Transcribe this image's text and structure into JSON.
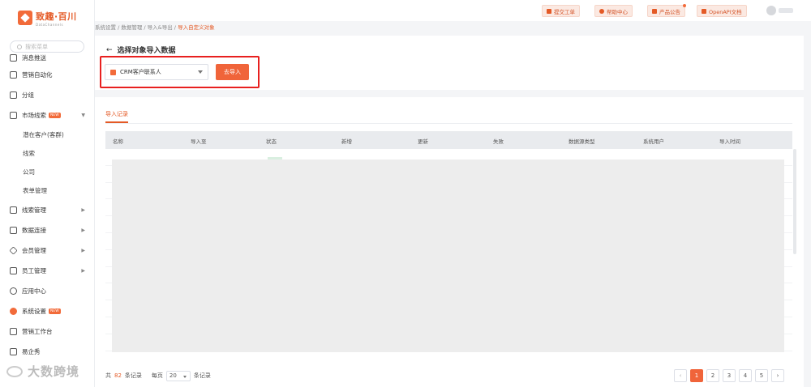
{
  "app": {
    "logo_main": "致趣·百川",
    "logo_sub": "DataChannels"
  },
  "sidebar": {
    "search_placeholder": "搜索菜单",
    "items": [
      {
        "label": "消息推送"
      },
      {
        "label": "营销自动化"
      },
      {
        "label": "分组"
      },
      {
        "label": "市场线索",
        "badge": "NEW"
      },
      {
        "label": "潜在客户(客群)"
      },
      {
        "label": "线索"
      },
      {
        "label": "公司"
      },
      {
        "label": "表单管理"
      },
      {
        "label": "线索管理"
      },
      {
        "label": "数据连接"
      },
      {
        "label": "会员管理"
      },
      {
        "label": "员工管理"
      },
      {
        "label": "应用中心"
      },
      {
        "label": "系统设置",
        "badge": "NEW"
      },
      {
        "label": "营销工作台"
      },
      {
        "label": "易企秀"
      }
    ]
  },
  "topbar": {
    "buttons": [
      "提交工单",
      "帮助中心",
      "产品公告",
      "OpenAPI文档"
    ]
  },
  "breadcrumb": {
    "items": [
      "系统设置",
      "数据管理",
      "导入&导出"
    ],
    "current": "导入自定义对象"
  },
  "import_panel": {
    "title": "选择对象导入数据",
    "select_value": "CRM客户联系人",
    "go_button": "去导入"
  },
  "records": {
    "tab": "导入记录",
    "columns": [
      "名称",
      "导入至",
      "状态",
      "新增",
      "更新",
      "失败",
      "数据源类型",
      "系统用户",
      "导入时间"
    ]
  },
  "footer": {
    "total_prefix": "共",
    "total": "82",
    "total_suffix": "条记录",
    "per_page_label": "每页",
    "per_page_value": "20",
    "per_page_suffix": "条记录",
    "pages": [
      "1",
      "2",
      "3",
      "4",
      "5"
    ],
    "current_page": "1",
    "prev": "‹",
    "next": "›"
  },
  "watermark": "大数跨境",
  "colors": {
    "accent": "#f0643a",
    "highlight_box": "#e8201f"
  }
}
